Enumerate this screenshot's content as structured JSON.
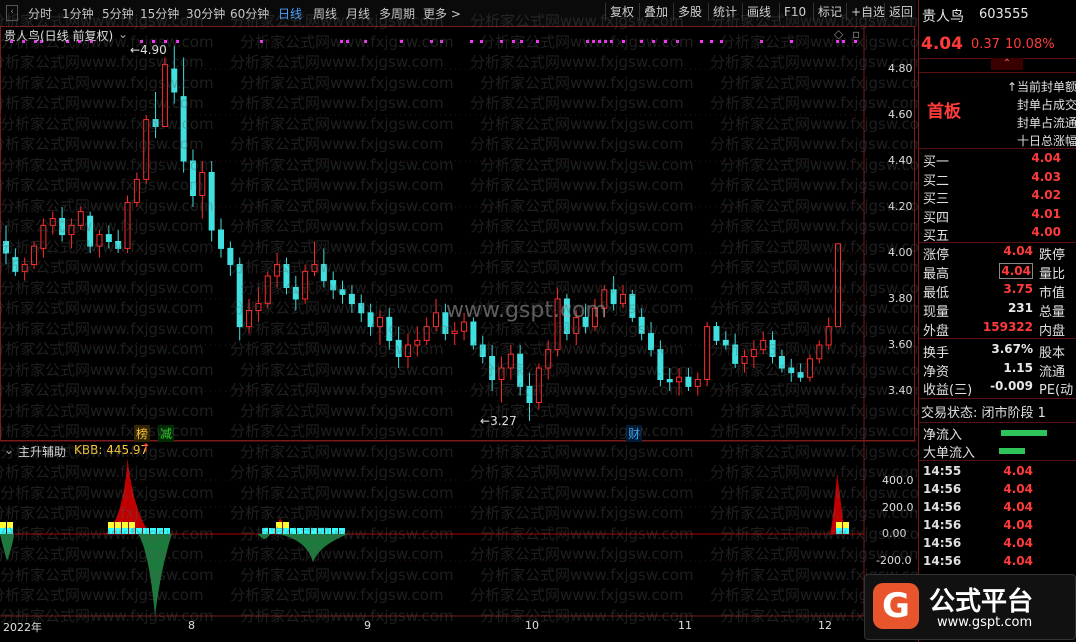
{
  "toolbar": {
    "periods": [
      "分时",
      "1分钟",
      "5分钟",
      "15分钟",
      "30分钟",
      "60分钟",
      "日线",
      "周线",
      "月线",
      "多周期",
      "更多 >"
    ],
    "active_period": "日线",
    "right_buttons": [
      "复权",
      "叠加",
      "多股",
      "统计",
      "画线",
      "F10",
      "标记",
      "+自选",
      "返回"
    ]
  },
  "chart": {
    "title": "贵人鸟(日线 前复权)",
    "high_label": "4.90",
    "low_label": "3.27",
    "price_axis": [
      "4.80",
      "4.60",
      "4.40",
      "4.20",
      "4.00",
      "3.80",
      "3.60",
      "3.40"
    ],
    "event_tags": [
      "榜",
      "减",
      "财"
    ],
    "indicator_name": "主升辅助",
    "indicator_value": "KBB: 445.97",
    "indicator_axis": [
      "400.0",
      "200.0",
      "0.00",
      "-200.0"
    ],
    "time_axis": [
      "2022年",
      "8",
      "9",
      "10",
      "11",
      "12"
    ],
    "center_watermark": "www.gspt.com"
  },
  "watermark_text": "分析家公式网www.fxjgsw.com",
  "colors": {
    "up": "#ff2a2a",
    "down": "#40e0e0",
    "bar_up": "#c00000",
    "bar_down": "#1c7a3c",
    "bg": "#000000"
  },
  "chart_data": {
    "type": "candlestick",
    "price_range": [
      3.27,
      4.9
    ],
    "indicator_range": [
      -300,
      550
    ]
  },
  "panel": {
    "stock_name": "贵人鸟",
    "stock_code": "603555",
    "price": "4.04",
    "change": "0.37",
    "change_pct": "10.08%",
    "tag": "首板",
    "notes": [
      "↑当前封单额",
      "封单占成交",
      "封单占流通",
      "十日总涨幅"
    ],
    "bids": [
      {
        "label": "买一",
        "value": "4.04"
      },
      {
        "label": "买二",
        "value": "4.03"
      },
      {
        "label": "买三",
        "value": "4.02"
      },
      {
        "label": "买四",
        "value": "4.01"
      },
      {
        "label": "买五",
        "value": "4.00"
      }
    ],
    "stats": [
      {
        "label": "涨停",
        "value": "4.04",
        "extra": "跌停"
      },
      {
        "label": "最高",
        "value": "4.04",
        "extra": "量比"
      },
      {
        "label": "最低",
        "value": "3.75",
        "extra": "市值"
      },
      {
        "label": "现量",
        "value": "231",
        "extra": "总量"
      },
      {
        "label": "外盘",
        "value": "159322",
        "extra": "内盘"
      }
    ],
    "stats2": [
      {
        "label": "换手",
        "value": "3.67%",
        "extra": "股本"
      },
      {
        "label": "净资",
        "value": "1.15",
        "extra": "流通"
      },
      {
        "label": "收益(三)",
        "value": "-0.009",
        "extra": "PE(动"
      }
    ],
    "trade_status": "交易状态: 闭市阶段 1",
    "flows": [
      {
        "label": "净流入"
      },
      {
        "label": "大单流入"
      }
    ],
    "ticks": [
      {
        "time": "14:55",
        "price": "4.04"
      },
      {
        "time": "14:56",
        "price": "4.04"
      },
      {
        "time": "14:56",
        "price": "4.04"
      },
      {
        "time": "14:56",
        "price": "4.04"
      },
      {
        "time": "14:56",
        "price": "4.04"
      },
      {
        "time": "14:56",
        "price": "4.04"
      },
      {
        "time": "14:56",
        "price": "4.04"
      }
    ]
  },
  "logo": {
    "text": "公式平台",
    "url": "www.gspt.com"
  }
}
